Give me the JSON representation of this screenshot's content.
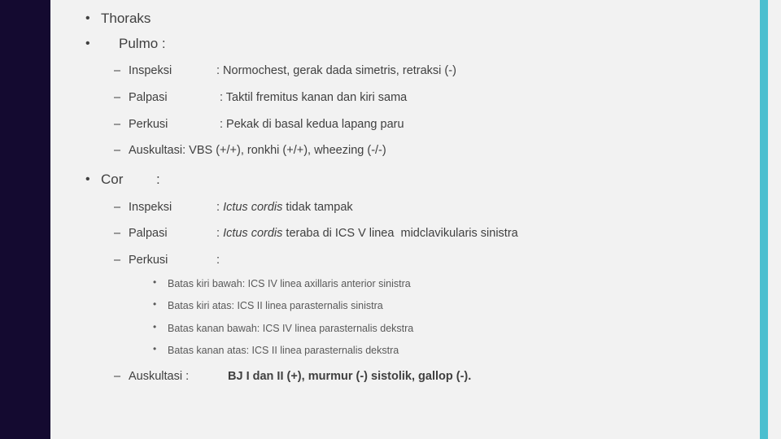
{
  "theme": {
    "background": "#f2f2f2",
    "left_band": "#140a30",
    "accent_bar": "#4bbfcf",
    "text": "#404040",
    "subtext": "#595959"
  },
  "bullets": {
    "dot": "•",
    "dash": "–",
    "small_dot": "•"
  },
  "slide": {
    "items": [
      {
        "level": 1,
        "text": "Thoraks"
      },
      {
        "level": 1,
        "text": "Pulmo  :"
      }
    ],
    "pulmo": {
      "heading": "Pulmo  :",
      "rows": [
        {
          "label": "Inspeksi",
          "value": ": Normochest, gerak dada simetris, retraksi (-)"
        },
        {
          "label": "Palpasi",
          "value": ": Taktil fremitus kanan dan kiri sama"
        },
        {
          "label": "Perkusi",
          "value": ": Pekak di basal kedua lapang paru"
        },
        {
          "label": "Auskultasi:",
          "value": "VBS (+/+), ronkhi (+/+), wheezing (-/-)"
        }
      ]
    },
    "cor": {
      "heading": "Cor",
      "heading_colon": ":",
      "rows": [
        {
          "label": "Inspeksi",
          "colon": ":",
          "italic": "Ictus cordis",
          "rest": " tidak tampak"
        },
        {
          "label": "Palpasi",
          "colon": ":",
          "italic": "Ictus cordis",
          "rest": " teraba di ICS V linea  midclavikularis sinistra"
        },
        {
          "label": "Perkusi",
          "colon": ":",
          "italic": "",
          "rest": ""
        }
      ],
      "batas": [
        "Batas kiri bawah: ICS IV linea axillaris anterior sinistra",
        "Batas kiri atas: ICS II linea parasternalis sinistra",
        "Batas kanan bawah: ICS IV linea parasternalis dekstra",
        "Batas kanan atas: ICS II linea parasternalis dekstra"
      ],
      "auskultasi": {
        "label": "Auskultasi :",
        "value": "BJ I dan II (+), murmur (-) sistolik, gallop (-)."
      }
    }
  }
}
